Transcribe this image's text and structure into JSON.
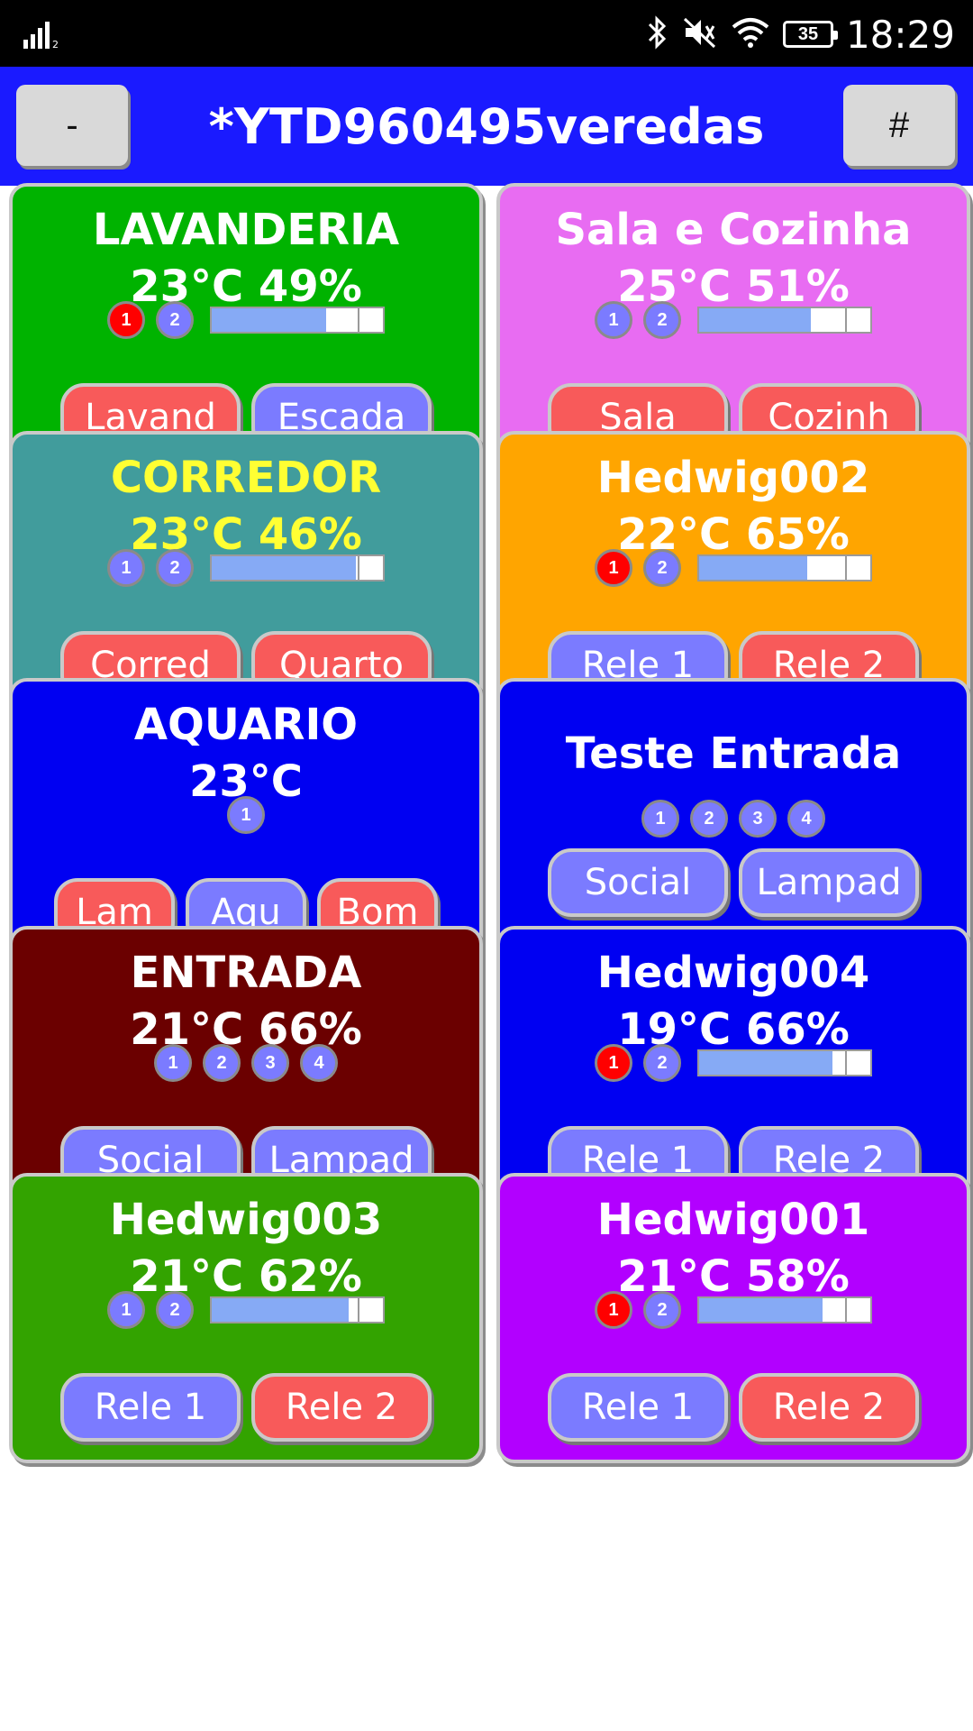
{
  "status_bar": {
    "signal_icon": "signal-bars-icon",
    "icons": [
      "bluetooth-icon",
      "mute-icon",
      "wifi-icon"
    ],
    "battery": "35",
    "time": "18:29"
  },
  "header": {
    "left_button": "-",
    "title": "*YTD960495veredas",
    "right_button": "#"
  },
  "colors": {
    "header_bg": "#1a1aff",
    "relay_on": "#ff0000",
    "relay_off": "#7b7bff",
    "button_red": "#f85a5a",
    "button_blue": "#7b7bff"
  },
  "cards": [
    {
      "name": "LAVANDERIA",
      "reading": "23°C 49%",
      "bg": "#00b300",
      "text": "#ffffff",
      "relays": [
        {
          "label": "1",
          "on": true
        },
        {
          "label": "2",
          "on": false
        }
      ],
      "level": 0.67,
      "buttons": [
        {
          "label": "Lavand",
          "color": "red"
        },
        {
          "label": "Escada",
          "color": "blue"
        }
      ]
    },
    {
      "name": "Sala e Cozinha",
      "reading": "25°C 51%",
      "bg": "#e86cf2",
      "text": "#ffffff",
      "relays": [
        {
          "label": "1",
          "on": false
        },
        {
          "label": "2",
          "on": false
        }
      ],
      "level": 0.65,
      "buttons": [
        {
          "label": "Sala",
          "color": "red"
        },
        {
          "label": "Cozinh",
          "color": "red"
        }
      ]
    },
    {
      "name": "CORREDOR",
      "reading": "23°C 46%",
      "bg": "#419c9c",
      "text": "#ffff33",
      "relays": [
        {
          "label": "1",
          "on": false
        },
        {
          "label": "2",
          "on": false
        }
      ],
      "level": 0.84,
      "buttons": [
        {
          "label": "Corred",
          "color": "red"
        },
        {
          "label": "Quarto",
          "color": "red"
        }
      ]
    },
    {
      "name": "Hedwig002",
      "reading": "22°C 65%",
      "bg": "#ffa500",
      "text": "#ffffff",
      "relays": [
        {
          "label": "1",
          "on": true
        },
        {
          "label": "2",
          "on": false
        }
      ],
      "level": 0.63,
      "buttons": [
        {
          "label": "Rele 1",
          "color": "blue"
        },
        {
          "label": "Rele 2",
          "color": "red"
        }
      ]
    },
    {
      "name": "AQUARIO",
      "reading": "23°C",
      "bg": "#0000f2",
      "text": "#ffffff",
      "relays": [
        {
          "label": "1",
          "on": false
        }
      ],
      "level": null,
      "buttons": [
        {
          "label": "Lam",
          "color": "red"
        },
        {
          "label": "Aqu",
          "color": "blue"
        },
        {
          "label": "Bom",
          "color": "red"
        }
      ]
    },
    {
      "name": "Teste Entrada",
      "reading": "",
      "bg": "#0000f2",
      "text": "#ffffff",
      "relays": [
        {
          "label": "1",
          "on": false
        },
        {
          "label": "2",
          "on": false
        },
        {
          "label": "3",
          "on": false
        },
        {
          "label": "4",
          "on": false
        }
      ],
      "level": null,
      "buttons": [
        {
          "label": "Social",
          "color": "blue"
        },
        {
          "label": "Lampad",
          "color": "blue"
        }
      ]
    },
    {
      "name": "ENTRADA",
      "reading": "21°C 66%",
      "bg": "#6b0000",
      "text": "#ffffff",
      "relays": [
        {
          "label": "1",
          "on": false
        },
        {
          "label": "2",
          "on": false
        },
        {
          "label": "3",
          "on": false
        },
        {
          "label": "4",
          "on": false
        }
      ],
      "level": null,
      "buttons": [
        {
          "label": "Social",
          "color": "blue"
        },
        {
          "label": "Lampad",
          "color": "blue"
        }
      ]
    },
    {
      "name": "Hedwig004",
      "reading": "19°C 66%",
      "bg": "#0000f2",
      "text": "#ffffff",
      "relays": [
        {
          "label": "1",
          "on": true
        },
        {
          "label": "2",
          "on": false
        }
      ],
      "level": 0.78,
      "buttons": [
        {
          "label": "Rele 1",
          "color": "blue"
        },
        {
          "label": "Rele 2",
          "color": "blue"
        }
      ]
    },
    {
      "name": "Hedwig003",
      "reading": "21°C 62%",
      "bg": "#33a300",
      "text": "#ffffff",
      "relays": [
        {
          "label": "1",
          "on": false
        },
        {
          "label": "2",
          "on": false
        }
      ],
      "level": 0.8,
      "buttons": [
        {
          "label": "Rele 1",
          "color": "blue"
        },
        {
          "label": "Rele 2",
          "color": "red"
        }
      ]
    },
    {
      "name": "Hedwig001",
      "reading": "21°C 58%",
      "bg": "#b200ff",
      "text": "#ffffff",
      "relays": [
        {
          "label": "1",
          "on": true
        },
        {
          "label": "2",
          "on": false
        }
      ],
      "level": 0.72,
      "buttons": [
        {
          "label": "Rele 1",
          "color": "blue"
        },
        {
          "label": "Rele 2",
          "color": "red"
        }
      ]
    }
  ]
}
